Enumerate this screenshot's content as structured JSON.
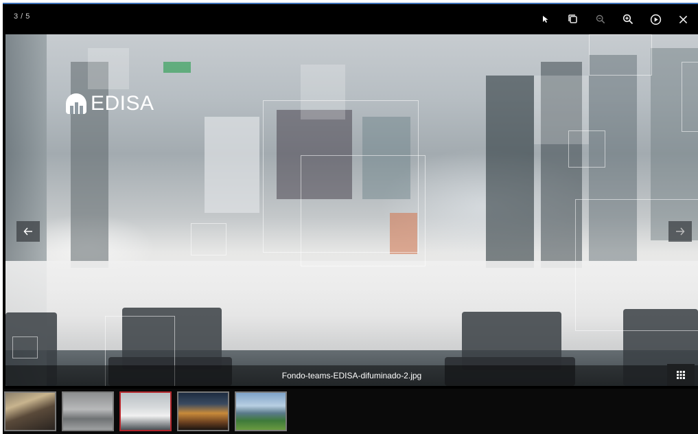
{
  "viewer": {
    "counter": "3 / 5",
    "caption": "Fondo-teams-EDISA-difuminado-2.jpg",
    "logo_text": "EDISA"
  },
  "toolbar": {
    "items": [
      {
        "name": "pointer",
        "icon": "cursor-icon"
      },
      {
        "name": "actual-size",
        "icon": "actual-size-icon"
      },
      {
        "name": "zoom-out",
        "icon": "zoom-out-icon"
      },
      {
        "name": "zoom-in",
        "icon": "zoom-in-icon"
      },
      {
        "name": "autoplay",
        "icon": "play-circle-icon"
      },
      {
        "name": "close",
        "icon": "close-icon"
      }
    ]
  },
  "navigation": {
    "prev_icon": "arrow-left-icon",
    "next_icon": "arrow-right-icon",
    "grid_icon": "grid-icon"
  },
  "thumbnails": [
    {
      "index": 1,
      "active": false
    },
    {
      "index": 2,
      "active": false
    },
    {
      "index": 3,
      "active": true
    },
    {
      "index": 4,
      "active": false
    },
    {
      "index": 5,
      "active": false
    }
  ],
  "colors": {
    "active_thumb_border": "#b5262b",
    "top_accent": "#3b6fb6"
  }
}
